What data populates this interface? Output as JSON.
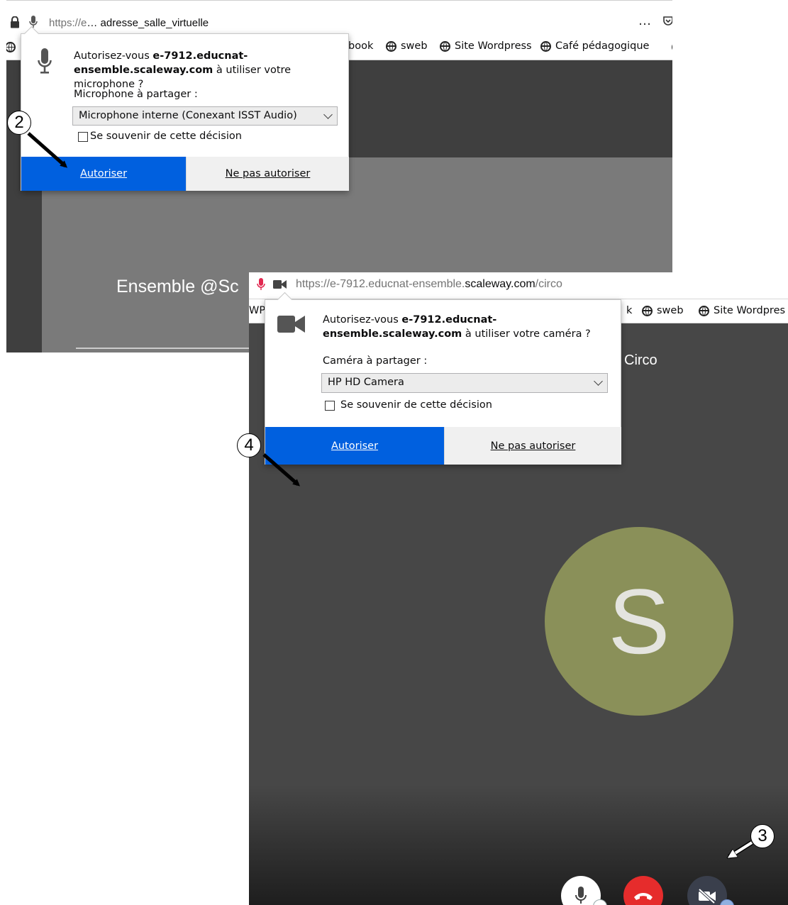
{
  "shot1": {
    "url": {
      "prefix": "https://e",
      "suffix": "… adresse_salle_virtuelle"
    },
    "menu_dots": "…",
    "bookmarks": [
      "book",
      "sweb",
      "Site Wordpress",
      "Café pédagogique"
    ],
    "page_title": "Ensemble @Sc",
    "prompt": {
      "question_start": "Autorisez-vous ",
      "host_line1": "e-7912.educnat-",
      "host_line2": "ensemble.scaleway.com",
      "question_end": " à utiliser votre microphone ?",
      "device_label": "Microphone à partager :",
      "device_value": "Microphone interne (Conexant ISST Audio)",
      "remember_label": "Se souvenir de cette décision",
      "allow_label": "Autoriser",
      "deny_label": "Ne pas autoriser"
    }
  },
  "shot2": {
    "url": {
      "part1": "https://e-7912.educnat-ensemble.",
      "part2": "scaleway.com",
      "part3": "/circo"
    },
    "bookmarks_left": "WP",
    "bookmarks": [
      "k",
      "sweb",
      "Site Wordpres"
    ],
    "room_name": "Circo",
    "avatar_letter": "S",
    "prompt": {
      "question_start": "Autorisez-vous ",
      "host_line1": "e-7912.educnat-",
      "host_line2": "ensemble.scaleway.com",
      "question_end": " à utiliser votre caméra ?",
      "device_label": "Caméra à partager :",
      "device_value": "HP HD Camera",
      "remember_label": "Se souvenir de cette décision",
      "allow_label": "Autoriser",
      "deny_label": "Ne pas autoriser"
    }
  },
  "steps": {
    "s2": "2",
    "s3": "3",
    "s4": "4"
  },
  "colors": {
    "allow_blue": "#0060df",
    "hangup_red": "#e62c2c",
    "avatar_green": "#8a9059"
  }
}
